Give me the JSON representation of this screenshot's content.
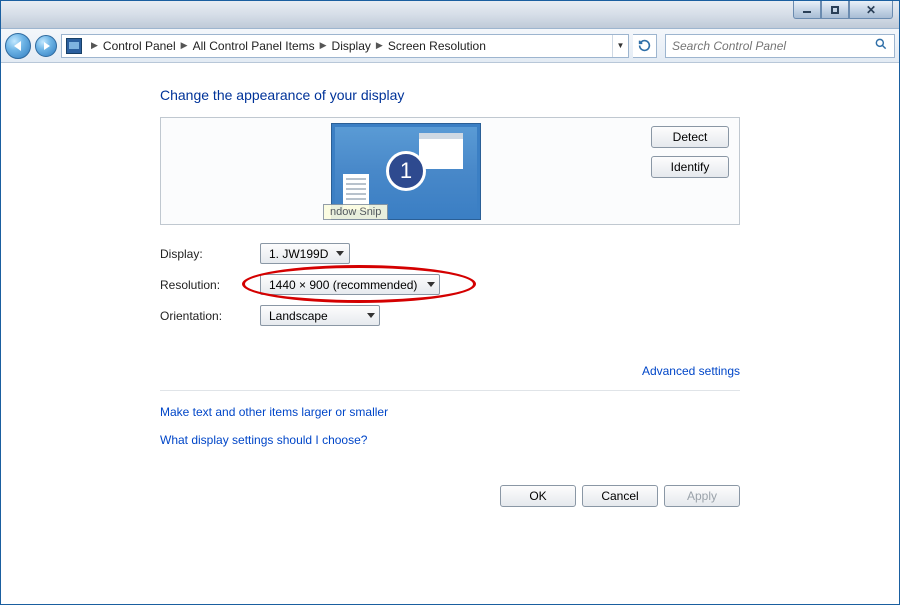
{
  "breadcrumb": {
    "items": [
      "Control Panel",
      "All Control Panel Items",
      "Display",
      "Screen Resolution"
    ]
  },
  "search": {
    "placeholder": "Search Control Panel"
  },
  "page": {
    "title": "Change the appearance of your display"
  },
  "monitor": {
    "number": "1",
    "tooltip": "ndow Snip"
  },
  "side_buttons": {
    "detect": "Detect",
    "identify": "Identify"
  },
  "form": {
    "display_label": "Display:",
    "display_value": "1. JW199D",
    "resolution_label": "Resolution:",
    "resolution_value": "1440 × 900 (recommended)",
    "orientation_label": "Orientation:",
    "orientation_value": "Landscape"
  },
  "links": {
    "advanced": "Advanced settings",
    "text_size": "Make text and other items larger or smaller",
    "help": "What display settings should I choose?"
  },
  "buttons": {
    "ok": "OK",
    "cancel": "Cancel",
    "apply": "Apply"
  }
}
